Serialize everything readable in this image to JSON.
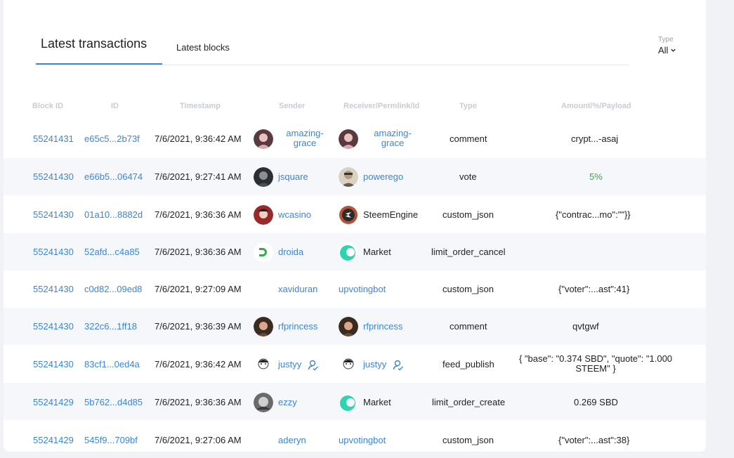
{
  "tabs": {
    "active": "Latest transactions",
    "inactive": "Latest blocks"
  },
  "type_filter": {
    "label": "Type",
    "value": "All"
  },
  "columns": [
    "Block ID",
    "ID",
    "Timestamp",
    "Sender",
    "Receiver/Permlink/Id",
    "Type",
    "Amount/%/Payload"
  ],
  "rows": [
    {
      "block": "55241431",
      "id": "e65c5...2b73f",
      "ts": "7/6/2021, 9:36:42 AM",
      "sender": "amazing-grace",
      "receiver": "amazing-grace",
      "type": "comment",
      "payload": "crypt...-asaj"
    },
    {
      "block": "55241430",
      "id": "e66b5...06474",
      "ts": "7/6/2021, 9:27:41 AM",
      "sender": "jsquare",
      "receiver": "powerego",
      "type": "vote",
      "payload": "5%"
    },
    {
      "block": "55241430",
      "id": "01a10...8882d",
      "ts": "7/6/2021, 9:36:36 AM",
      "sender": "wcasino",
      "receiver": "SteemEngine",
      "type": "custom_json",
      "payload": "{\"contrac...mo\":\"\"}}"
    },
    {
      "block": "55241430",
      "id": "52afd...c4a85",
      "ts": "7/6/2021, 9:36:36 AM",
      "sender": "droida",
      "receiver": "Market",
      "type": "limit_order_cancel",
      "payload": ""
    },
    {
      "block": "55241430",
      "id": "c0d82...09ed8",
      "ts": "7/6/2021, 9:27:09 AM",
      "sender": "xaviduran",
      "receiver": "upvotingbot",
      "type": "custom_json",
      "payload": "{\"voter\":...ast\":41}"
    },
    {
      "block": "55241430",
      "id": "322c6...1ff18",
      "ts": "7/6/2021, 9:36:39 AM",
      "sender": "rfprincess",
      "receiver": "rfprincess",
      "type": "comment",
      "payload": "qvtgwf"
    },
    {
      "block": "55241430",
      "id": "83cf1...0ed4a",
      "ts": "7/6/2021, 9:36:42 AM",
      "sender": "justyy",
      "receiver": "justyy",
      "type": "feed_publish",
      "payload": "{ \"base\": \"0.374 SBD\", \"quote\": \"1.000 STEEM\" }"
    },
    {
      "block": "55241429",
      "id": "5b762...d4d85",
      "ts": "7/6/2021, 9:36:36 AM",
      "sender": "ezzy",
      "receiver": "Market",
      "type": "limit_order_create",
      "payload": "0.269 SBD"
    },
    {
      "block": "55241429",
      "id": "545f9...709bf",
      "ts": "7/6/2021, 9:27:06 AM",
      "sender": "aderyn",
      "receiver": "upvotingbot",
      "type": "custom_json",
      "payload": "{\"voter\":...ast\":38}"
    }
  ],
  "name_lines": {
    "amazing_1": "amazing-",
    "amazing_2": "grace"
  },
  "payload_lines": {
    "feed_1": "{ \"base\": \"0.374 SBD\", \"quote\": \"1.000",
    "feed_2": "STEEM\" }"
  },
  "colors": {
    "accent": "#3a86d8",
    "positive": "#3fa34d",
    "row_alt": "#f6f7fb"
  },
  "icons": [
    "chevron-down-icon",
    "user-avatar",
    "steemengine-logo-icon",
    "market-logo-icon",
    "droida-logo-icon",
    "witness-user-icon"
  ]
}
